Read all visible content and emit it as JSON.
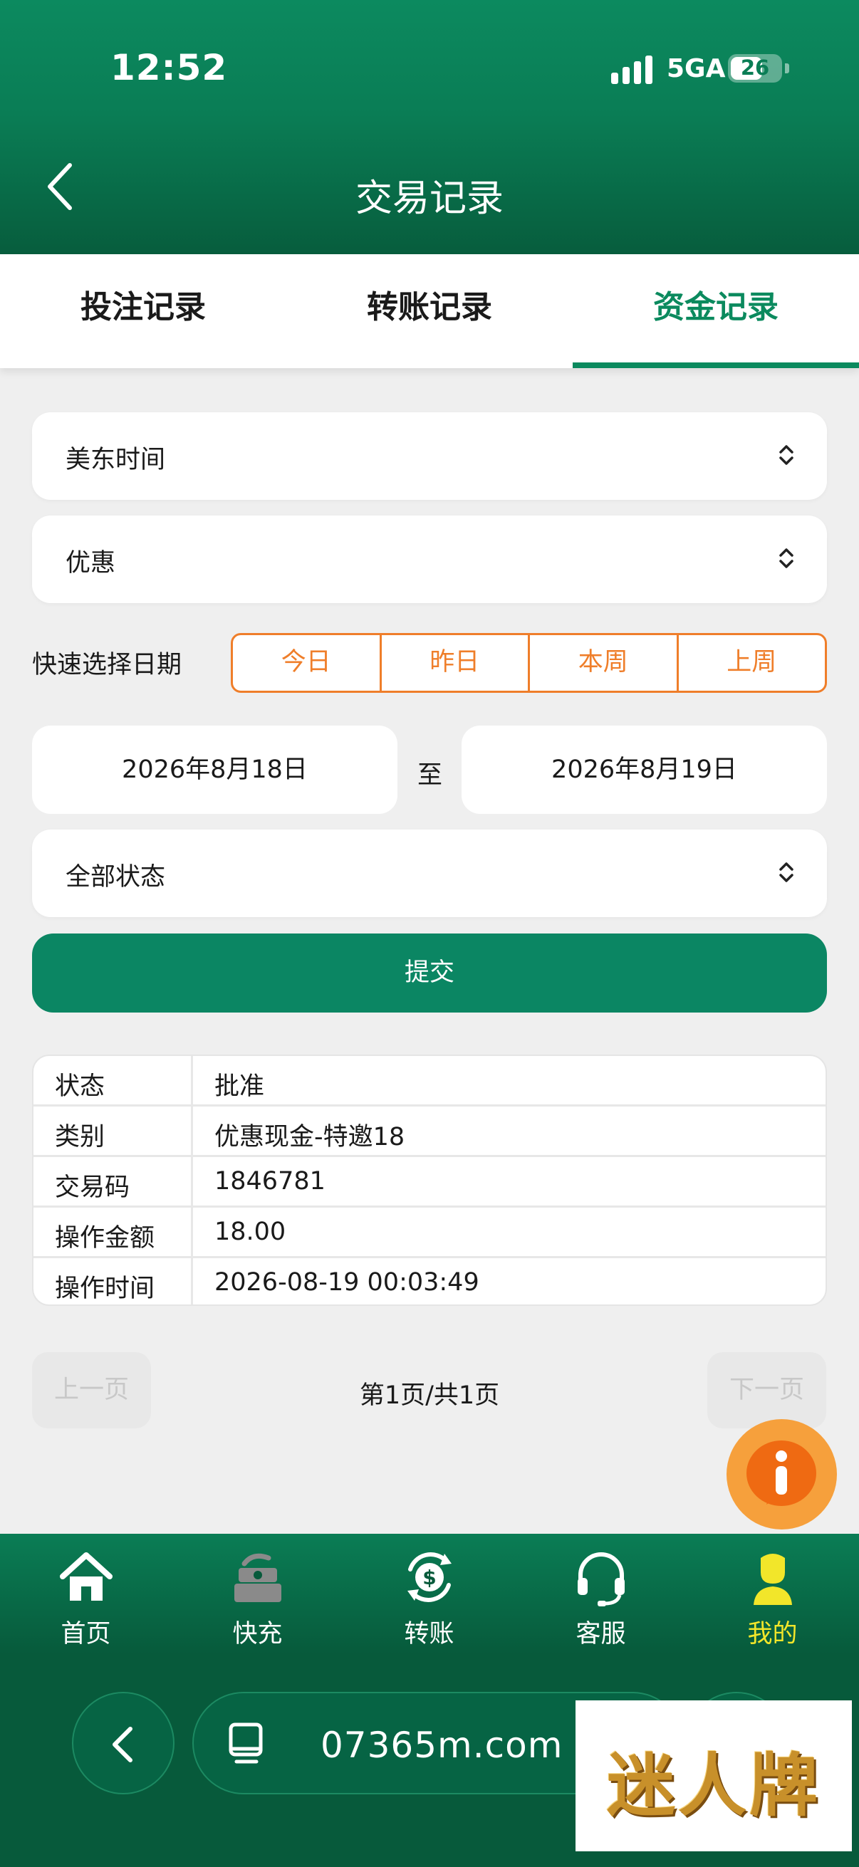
{
  "status_bar": {
    "time": "12:52",
    "network": "5GA",
    "battery": "26"
  },
  "header": {
    "title": "交易记录"
  },
  "tabs": [
    {
      "label": "投注记录",
      "active": false
    },
    {
      "label": "转账记录",
      "active": false
    },
    {
      "label": "资金记录",
      "active": true
    }
  ],
  "filters": {
    "timezone": "美东时间",
    "category": "优惠",
    "quick_label": "快速选择日期",
    "quick_options": [
      "今日",
      "昨日",
      "本周",
      "上周"
    ],
    "date_from": "2026年8月18日",
    "date_separator": "至",
    "date_to": "2026年8月19日",
    "status": "全部状态",
    "submit_label": "提交"
  },
  "record": [
    {
      "key": "状态",
      "value": "批准"
    },
    {
      "key": "类别",
      "value": "优惠现金-特邀18"
    },
    {
      "key": "交易码",
      "value": "1846781"
    },
    {
      "key": "操作金额",
      "value": "18.00"
    },
    {
      "key": "操作时间",
      "value": "2026-08-19 00:03:49"
    }
  ],
  "pager": {
    "prev": "上一页",
    "info": "第1页/共1页",
    "next": "下一页"
  },
  "bottom_nav": [
    {
      "label": "首页",
      "icon": "home-icon"
    },
    {
      "label": "快充",
      "icon": "cash-register-icon"
    },
    {
      "label": "转账",
      "icon": "dollar-transfer-icon"
    },
    {
      "label": "客服",
      "icon": "headset-icon"
    },
    {
      "label": "我的",
      "icon": "user-icon",
      "active": true
    }
  ],
  "browser": {
    "url": "07365m.com"
  },
  "watermark": {
    "text": "迷人牌"
  },
  "colors": {
    "primary": "#0b8663",
    "accent": "#ef7e2a",
    "nav_active": "#f2e62a"
  }
}
